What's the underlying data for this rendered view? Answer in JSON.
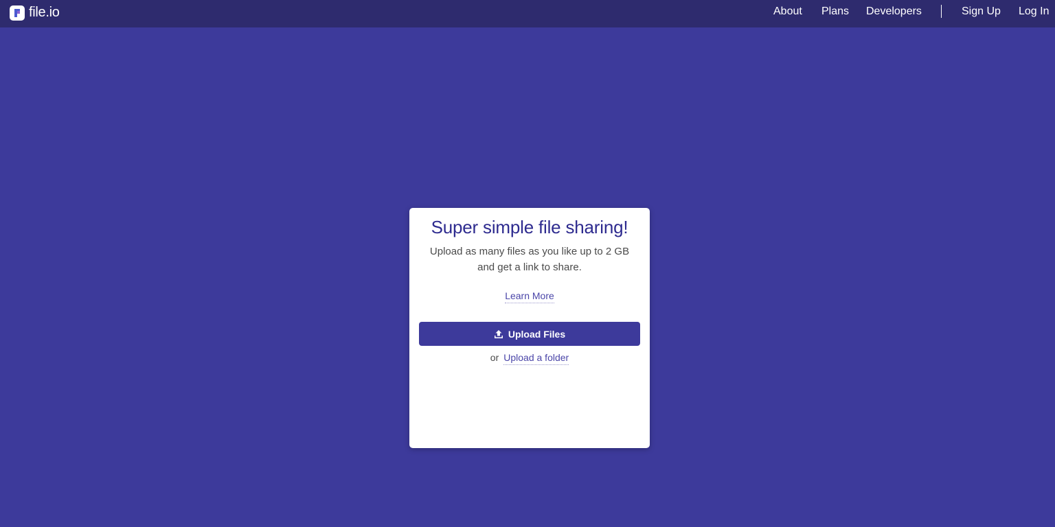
{
  "colors": {
    "background": "#3d3a9b",
    "navbar": "#2e2b6e",
    "card": "#ffffff",
    "title": "#2e2b8f",
    "button": "#3d3a9b",
    "link": "#4a45a8"
  },
  "navbar": {
    "brand_icon": "file-io-logo-icon",
    "brand": "file.io",
    "links": [
      {
        "label": "About"
      },
      {
        "label": "Plans"
      },
      {
        "label": "Developers"
      }
    ],
    "auth": {
      "sign_up": "Sign Up",
      "log_in": "Log In"
    }
  },
  "card": {
    "title": "Super simple file sharing!",
    "description_line1": "Upload as many files as you like up to 2 GB",
    "description_line2": "and get a link to share.",
    "learn_more": "Learn More",
    "upload_button": {
      "icon": "upload-icon",
      "label": "Upload Files"
    },
    "or_text": "or",
    "upload_folder": "Upload a folder"
  }
}
